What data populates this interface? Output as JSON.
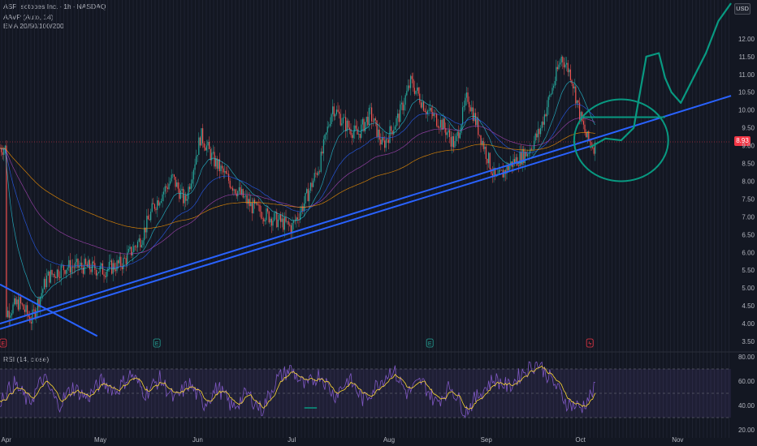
{
  "header": {
    "symbol": "ASP Isotopes Inc.",
    "interval": "1h",
    "exchange": "NASDAQ",
    "sep": "·",
    "indicator1": "AAVP (Auto, 14)",
    "indicator2": "EMA 20/50/100/200"
  },
  "currency_badge": "USD",
  "last_price": "8.93",
  "rsi_label": "RSI (14, close)",
  "event_markers": [
    "E",
    "E",
    "E",
    "ϟ"
  ],
  "colors": {
    "background": "#131722",
    "trendline": "#2962ff",
    "drawing": "#089981",
    "up": "#26a69a",
    "down": "#ef5350",
    "rsi_line": "#7e57c2",
    "rsi_ma": "#fdd835",
    "last_price": "#f23645"
  },
  "chart_data": [
    {
      "type": "candlestick",
      "title": "ASP Isotopes Inc. · 1h · NASDAQ",
      "ylim": [
        3.25,
        13.0
      ],
      "price_ticks": [
        "12.00",
        "11.50",
        "11.00",
        "10.50",
        "10.00",
        "9.50",
        "9.00",
        "8.50",
        "8.00",
        "7.50",
        "7.00",
        "6.50",
        "6.00",
        "5.50",
        "5.00",
        "4.50",
        "4.00",
        "3.50"
      ],
      "x_ticks": [
        "Apr",
        "May",
        "Jun",
        "Jul",
        "Aug",
        "Sep",
        "Oct",
        "Nov"
      ],
      "close_path": {
        "dates": [
          "Apr 1",
          "Apr 5",
          "Apr 9",
          "Apr 14",
          "Apr 20",
          "Apr 26",
          "May 2",
          "May 8",
          "May 14",
          "May 18",
          "May 24",
          "May 28",
          "Jun 2",
          "Jun 6",
          "Jun 12",
          "Jun 18",
          "Jun 24",
          "Jul 1",
          "Jul 5",
          "Jul 10",
          "Jul 14",
          "Jul 18",
          "Jul 22",
          "Jul 26",
          "Jul 30",
          "Aug 4",
          "Aug 8",
          "Aug 13",
          "Aug 18",
          "Aug 22",
          "Aug 26",
          "Aug 30",
          "Sep 4",
          "Sep 9",
          "Sep 14",
          "Sep 18",
          "Sep 22",
          "Sep 25",
          "Sep 28",
          "Oct 1",
          "Oct 3",
          "Oct 6"
        ],
        "close": [
          4.3,
          4.6,
          4.1,
          5.3,
          5.6,
          5.6,
          5.5,
          5.7,
          6.4,
          7.3,
          8.1,
          7.4,
          9.3,
          8.6,
          7.9,
          7.3,
          7.0,
          6.7,
          7.4,
          8.5,
          10.1,
          9.6,
          9.3,
          9.9,
          9.0,
          9.8,
          10.8,
          10.0,
          9.6,
          9.0,
          10.4,
          9.3,
          8.0,
          8.5,
          8.8,
          9.4,
          10.6,
          11.5,
          11.0,
          9.8,
          9.2,
          8.93
        ]
      },
      "last_close": 8.93,
      "ema": [
        "20",
        "50",
        "100",
        "200"
      ],
      "trendlines": [
        {
          "name": "upper support",
          "from": [
            "Mar 30",
            4.0
          ],
          "to": [
            "Nov 18",
            10.4
          ]
        },
        {
          "name": "lower support",
          "from": [
            "Mar 30",
            3.85
          ],
          "to": [
            "Oct 4",
            8.98
          ]
        },
        {
          "name": "resistance",
          "from": [
            "Mar 30",
            5.1
          ],
          "to": [
            "Apr 30",
            3.65
          ]
        }
      ],
      "projection": {
        "dates": [
          "Oct 4",
          "Oct 9",
          "Oct 14",
          "Oct 18",
          "Oct 22",
          "Oct 26",
          "Oct 28",
          "Oct 30",
          "Nov 2",
          "Nov 6",
          "Nov 10",
          "Nov 14",
          "Nov 18"
        ],
        "values": [
          8.95,
          9.2,
          9.15,
          9.5,
          11.5,
          11.6,
          10.9,
          10.5,
          10.2,
          10.9,
          11.6,
          12.5,
          13.0
        ]
      },
      "target_level": 9.8,
      "circled_zone": {
        "dates": [
          "Sep 29",
          "Oct 29"
        ],
        "price": [
          8.0,
          10.3
        ]
      }
    },
    {
      "type": "line",
      "title": "RSI (14, close)",
      "ylim": [
        20,
        80
      ],
      "y_ticks": [
        "80.00",
        "60.00",
        "40.00",
        "20.00"
      ],
      "bands": [
        70,
        50,
        30
      ],
      "series": [
        {
          "values": [
            45,
            58,
            42,
            63,
            40,
            55,
            46,
            60,
            52,
            66,
            50,
            62,
            44,
            58,
            41,
            55,
            38,
            50,
            36,
            61,
            70,
            55,
            66,
            48,
            62,
            44,
            58,
            70,
            50,
            60,
            42,
            56,
            35,
            50,
            62,
            55,
            68,
            75,
            60,
            42,
            38,
            55
          ]
        }
      ]
    }
  ]
}
